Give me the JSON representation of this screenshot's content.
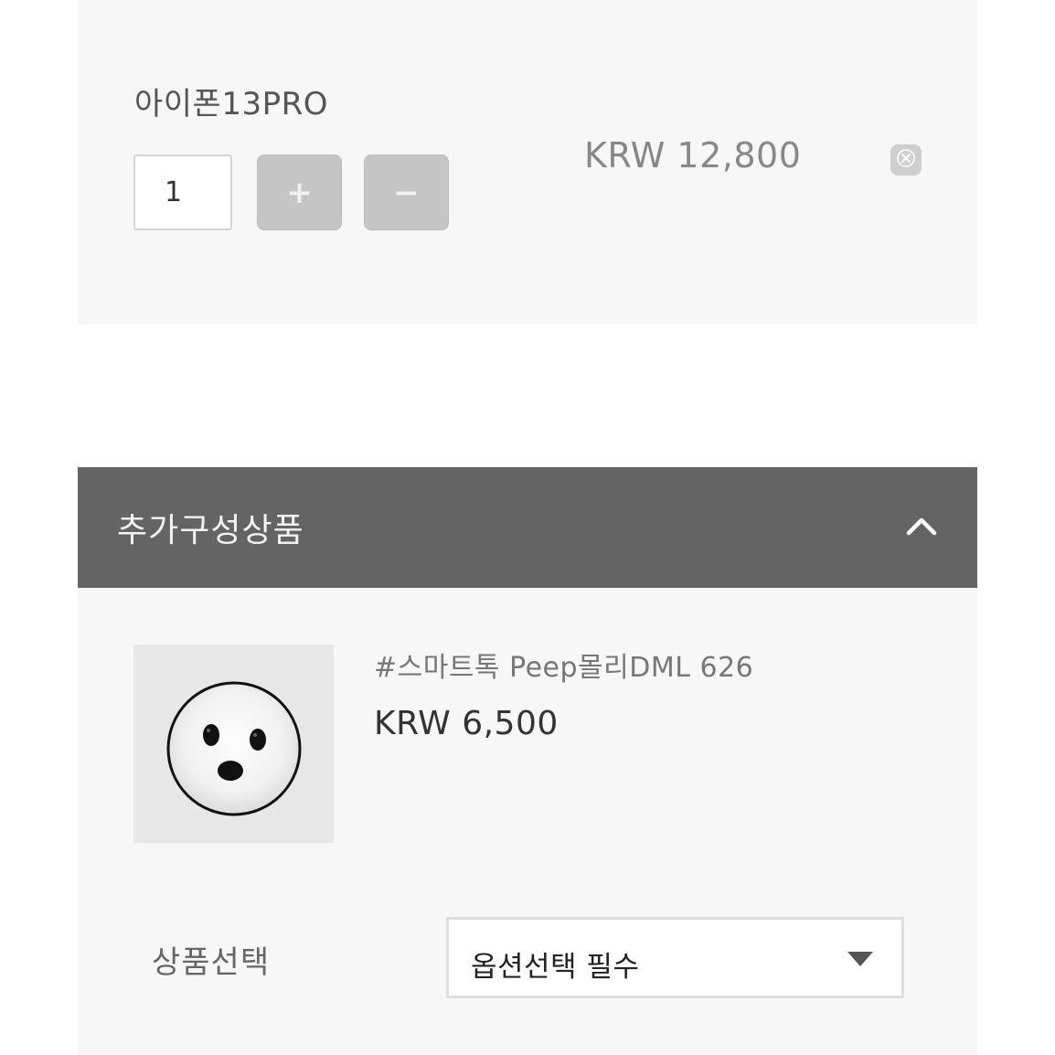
{
  "selected_item": {
    "name": "아이폰13PRO",
    "quantity": "1",
    "plus_label": "+",
    "minus_label": "−",
    "price": "KRW 12,800",
    "remove_icon": "close-icon"
  },
  "addon_section": {
    "title": "추가구성상품",
    "toggle_icon": "chevron-up-icon",
    "product": {
      "thumbnail_icon": "peep-griptok-image",
      "name": "#스마트톡 Peep몰리DML 626",
      "price": "KRW 6,500"
    },
    "option": {
      "label": "상품선택",
      "selected_value": "옵션선택 필수",
      "dropdown_icon": "caret-down-icon"
    }
  }
}
